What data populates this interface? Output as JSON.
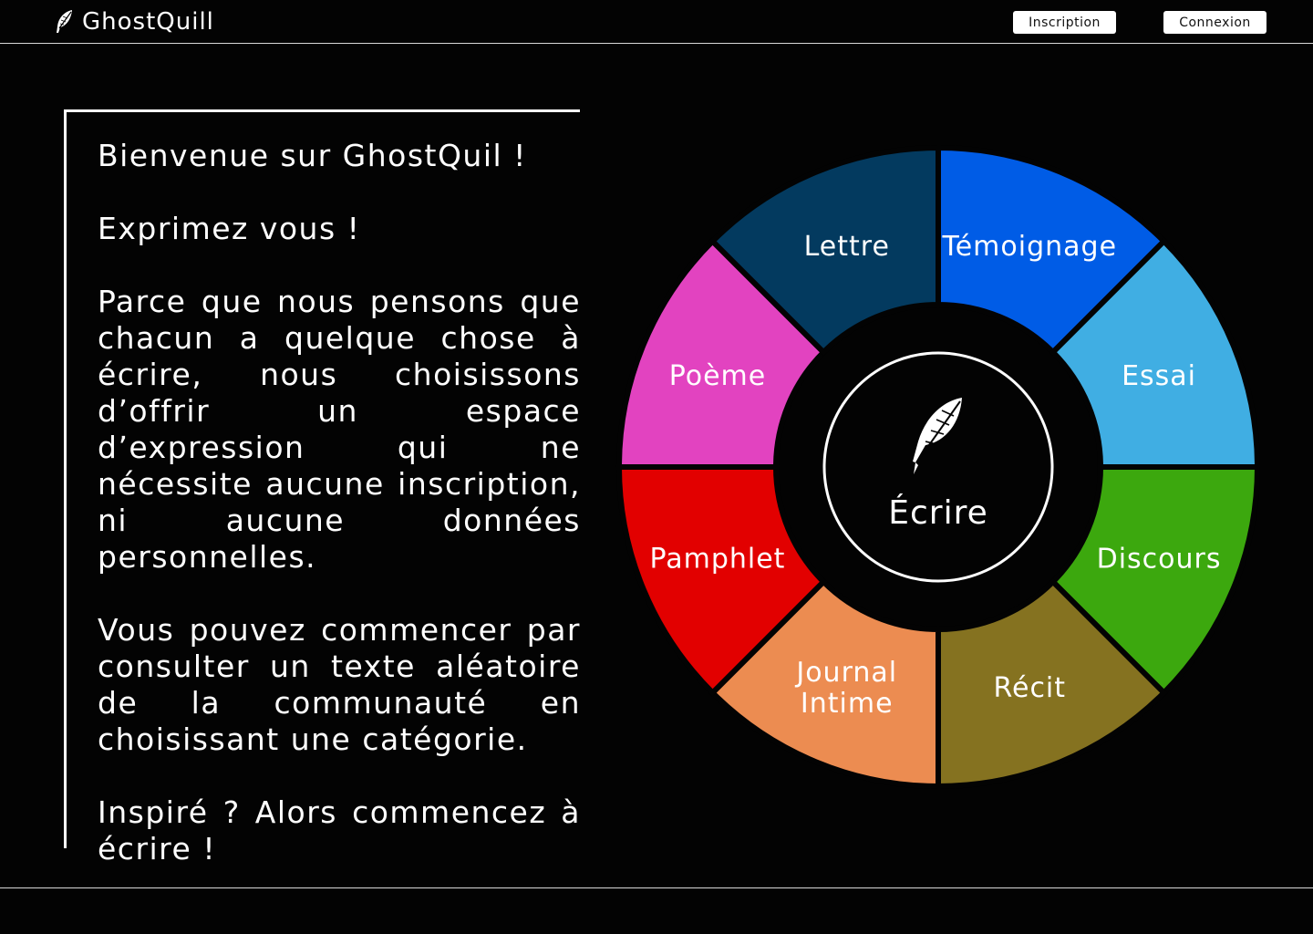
{
  "app": {
    "name": "GhostQuill",
    "logo_icon": "quill-icon"
  },
  "header": {
    "signup_label": "Inscription",
    "login_label": "Connexion"
  },
  "intro": {
    "paragraphs": [
      "Bienvenue sur GhostQuil !",
      "Exprimez vous !",
      "Parce que nous pensons que chacun a quelque chose à écrire, nous choisissons d’offrir un espace d’expression qui ne nécessite aucune inscription, ni aucune données personnelles.",
      "Vous pouvez commencer par consulter un texte aléatoire de la communauté en choisissant une catégorie.",
      "Inspiré ? Alors commencez à écrire !"
    ]
  },
  "wheel": {
    "center_label": "Écrire",
    "center_icon": "quill-icon",
    "categories": [
      {
        "label": "Témoignage",
        "color": "#005ce6"
      },
      {
        "label": "Essai",
        "color": "#40aee3"
      },
      {
        "label": "Discours",
        "color": "#3ca80e"
      },
      {
        "label": "Récit",
        "color": "#857220"
      },
      {
        "label": "Journal Intime",
        "color": "#ec8c51"
      },
      {
        "label": "Pamphlet",
        "color": "#e20000"
      },
      {
        "label": "Poème",
        "color": "#e243c0"
      },
      {
        "label": "Lettre",
        "color": "#033a5f"
      }
    ]
  },
  "theme": {
    "background": "#030303",
    "border": "#ffffff"
  }
}
